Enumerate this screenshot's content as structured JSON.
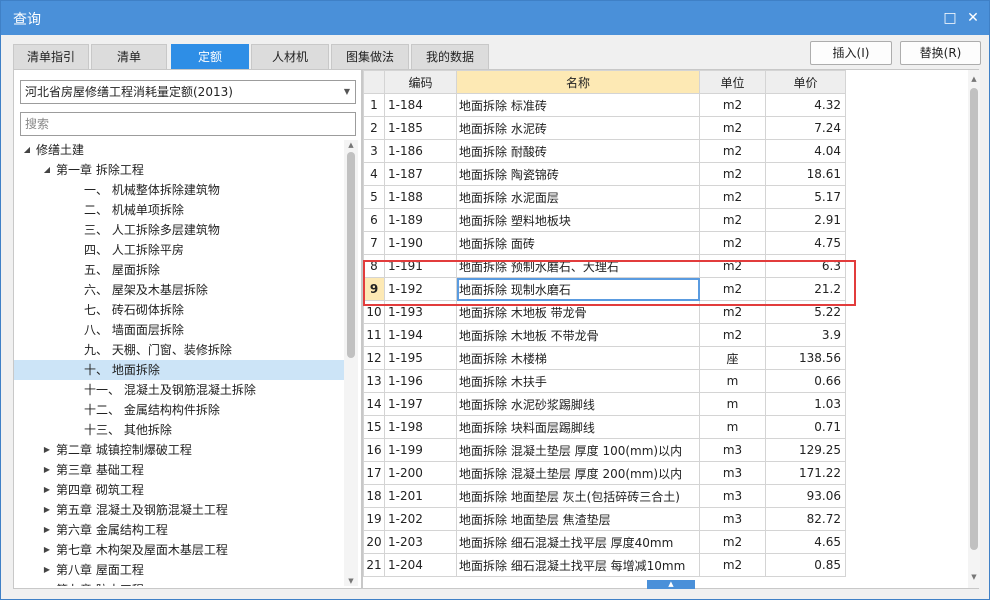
{
  "window": {
    "title": "查询"
  },
  "title_buttons": {
    "maximize": "□",
    "close": "✕"
  },
  "tabs": [
    {
      "label": "清单指引"
    },
    {
      "label": "清单"
    },
    {
      "label": "定额"
    },
    {
      "label": "人材机"
    },
    {
      "label": "图集做法"
    },
    {
      "label": "我的数据"
    }
  ],
  "buttons": {
    "insert": "插入(I)",
    "replace": "替换(R)"
  },
  "library": {
    "selected": "河北省房屋修缮工程消耗量定额(2013)"
  },
  "search": {
    "placeholder": "搜索"
  },
  "tree": [
    {
      "label": "修缮土建",
      "level": 0,
      "toggle": "expanded"
    },
    {
      "label": "第一章 拆除工程",
      "level": 1,
      "toggle": "expanded"
    },
    {
      "label": "一、 机械整体拆除建筑物",
      "level": 2
    },
    {
      "label": "二、 机械单项拆除",
      "level": 2
    },
    {
      "label": "三、 人工拆除多层建筑物",
      "level": 2
    },
    {
      "label": "四、 人工拆除平房",
      "level": 2
    },
    {
      "label": "五、 屋面拆除",
      "level": 2
    },
    {
      "label": "六、 屋架及木基层拆除",
      "level": 2
    },
    {
      "label": "七、 砖石砌体拆除",
      "level": 2
    },
    {
      "label": "八、 墙面面层拆除",
      "level": 2
    },
    {
      "label": "九、 天棚、门窗、装修拆除",
      "level": 2
    },
    {
      "label": "十、 地面拆除",
      "level": 2,
      "selected": true
    },
    {
      "label": "十一、 混凝土及钢筋混凝土拆除",
      "level": 2
    },
    {
      "label": "十二、 金属结构构件拆除",
      "level": 2
    },
    {
      "label": "十三、 其他拆除",
      "level": 2
    },
    {
      "label": "第二章 城镇控制爆破工程",
      "level": 1,
      "toggle": "collapsed"
    },
    {
      "label": "第三章 基础工程",
      "level": 1,
      "toggle": "collapsed"
    },
    {
      "label": "第四章 砌筑工程",
      "level": 1,
      "toggle": "collapsed"
    },
    {
      "label": "第五章 混凝土及钢筋混凝土工程",
      "level": 1,
      "toggle": "collapsed"
    },
    {
      "label": "第六章 金属结构工程",
      "level": 1,
      "toggle": "collapsed"
    },
    {
      "label": "第七章 木构架及屋面木基层工程",
      "level": 1,
      "toggle": "collapsed"
    },
    {
      "label": "第八章 屋面工程",
      "level": 1,
      "toggle": "collapsed"
    },
    {
      "label": "第九章 防水工程",
      "level": 1,
      "toggle": "collapsed"
    }
  ],
  "grid": {
    "columns": [
      "编码",
      "名称",
      "单位",
      "单价"
    ],
    "current_row": 9,
    "rows": [
      {
        "no": "1",
        "code": "1-184",
        "name": "地面拆除 标准砖",
        "unit": "m2",
        "price": "4.32"
      },
      {
        "no": "2",
        "code": "1-185",
        "name": "地面拆除 水泥砖",
        "unit": "m2",
        "price": "7.24"
      },
      {
        "no": "3",
        "code": "1-186",
        "name": "地面拆除 耐酸砖",
        "unit": "m2",
        "price": "4.04"
      },
      {
        "no": "4",
        "code": "1-187",
        "name": "地面拆除 陶瓷锦砖",
        "unit": "m2",
        "price": "18.61"
      },
      {
        "no": "5",
        "code": "1-188",
        "name": "地面拆除 水泥面层",
        "unit": "m2",
        "price": "5.17"
      },
      {
        "no": "6",
        "code": "1-189",
        "name": "地面拆除 塑料地板块",
        "unit": "m2",
        "price": "2.91"
      },
      {
        "no": "7",
        "code": "1-190",
        "name": "地面拆除 面砖",
        "unit": "m2",
        "price": "4.75"
      },
      {
        "no": "8",
        "code": "1-191",
        "name": "地面拆除 预制水磨石、大理石",
        "unit": "m2",
        "price": "6.3"
      },
      {
        "no": "9",
        "code": "1-192",
        "name": "地面拆除 现制水磨石",
        "unit": "m2",
        "price": "21.2"
      },
      {
        "no": "10",
        "code": "1-193",
        "name": "地面拆除 木地板 带龙骨",
        "unit": "m2",
        "price": "5.22"
      },
      {
        "no": "11",
        "code": "1-194",
        "name": "地面拆除 木地板 不带龙骨",
        "unit": "m2",
        "price": "3.9"
      },
      {
        "no": "12",
        "code": "1-195",
        "name": "地面拆除 木楼梯",
        "unit": "座",
        "price": "138.56"
      },
      {
        "no": "13",
        "code": "1-196",
        "name": "地面拆除 木扶手",
        "unit": "m",
        "price": "0.66"
      },
      {
        "no": "14",
        "code": "1-197",
        "name": "地面拆除 水泥砂浆踢脚线",
        "unit": "m",
        "price": "1.03"
      },
      {
        "no": "15",
        "code": "1-198",
        "name": "地面拆除 块料面层踢脚线",
        "unit": "m",
        "price": "0.71"
      },
      {
        "no": "16",
        "code": "1-199",
        "name": "地面拆除 混凝土垫层 厚度 100(mm)以内",
        "unit": "m3",
        "price": "129.25"
      },
      {
        "no": "17",
        "code": "1-200",
        "name": "地面拆除 混凝土垫层 厚度 200(mm)以内",
        "unit": "m3",
        "price": "171.22"
      },
      {
        "no": "18",
        "code": "1-201",
        "name": "地面拆除 地面垫层 灰土(包括碎砖三合土)",
        "unit": "m3",
        "price": "93.06"
      },
      {
        "no": "19",
        "code": "1-202",
        "name": "地面拆除 地面垫层 焦渣垫层",
        "unit": "m3",
        "price": "82.72"
      },
      {
        "no": "20",
        "code": "1-203",
        "name": "地面拆除 细石混凝土找平层 厚度40mm",
        "unit": "m2",
        "price": "4.65"
      },
      {
        "no": "21",
        "code": "1-204",
        "name": "地面拆除 细石混凝土找平层 每增减10mm",
        "unit": "m2",
        "price": "0.85"
      }
    ]
  },
  "colors": {
    "titlebar": "#4a90d9",
    "active_tab": "#2e8ee6",
    "highlight_box": "#e23c3c",
    "current_row": "#fde9b4",
    "tree_selected": "#cce4f7"
  },
  "icons": {
    "maximize": "maximize-icon",
    "close": "close-icon",
    "dropdown": "chevron-down-icon",
    "tree_expanded": "triangle-down-icon",
    "tree_collapsed": "triangle-right-icon"
  }
}
